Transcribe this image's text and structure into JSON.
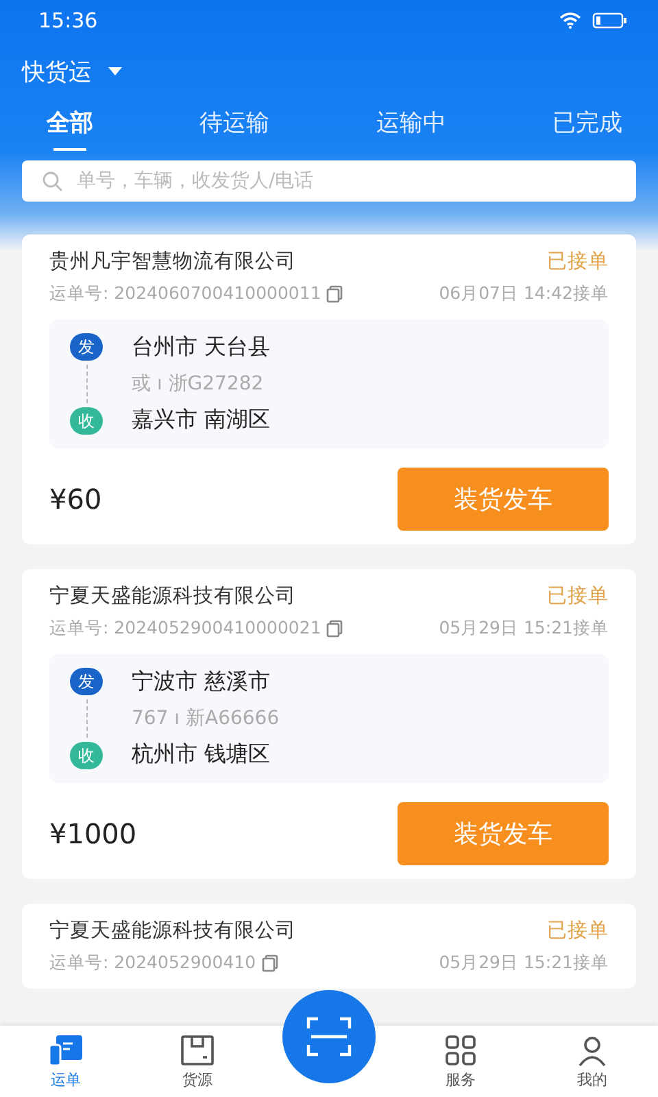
{
  "status_bar": {
    "time": "15:36"
  },
  "header": {
    "title": "快货运"
  },
  "tabs": [
    {
      "label": "全部",
      "selected": true
    },
    {
      "label": "待运输",
      "selected": false
    },
    {
      "label": "运输中",
      "selected": false
    },
    {
      "label": "已完成",
      "selected": false
    }
  ],
  "search": {
    "placeholder": "单号，车辆，收发货人/电话"
  },
  "orders": [
    {
      "company": "贵州凡宇智慧物流有限公司",
      "status": "已接单",
      "waybill": "运单号: 2024060700410000011",
      "time": "06月07日 14:42接单",
      "from_tag": "发",
      "from": "台州市 天台县",
      "vehicle": "或 ı 浙G27282",
      "to_tag": "收",
      "to": "嘉兴市 南湖区",
      "price": "¥60",
      "action": "装货发车"
    },
    {
      "company": "宁夏天盛能源科技有限公司",
      "status": "已接单",
      "waybill": "运单号: 2024052900410000021",
      "time": "05月29日 15:21接单",
      "from_tag": "发",
      "from": "宁波市 慈溪市",
      "vehicle": "767 ı 新A66666",
      "to_tag": "收",
      "to": "杭州市 钱塘区",
      "price": "¥1000",
      "action": "装货发车"
    },
    {
      "company": "宁夏天盛能源科技有限公司",
      "status": "已接单",
      "waybill": "运单号: 2024052900410",
      "time": "05月29日 15:21接单"
    }
  ],
  "bottom_nav": [
    {
      "label": "运单",
      "selected": true,
      "kind": "waybill"
    },
    {
      "label": "货源",
      "selected": false,
      "kind": "box"
    },
    {
      "kind": "scan",
      "selected": false
    },
    {
      "label": "服务",
      "selected": false,
      "kind": "service"
    },
    {
      "label": "我的",
      "selected": false,
      "kind": "user"
    }
  ]
}
